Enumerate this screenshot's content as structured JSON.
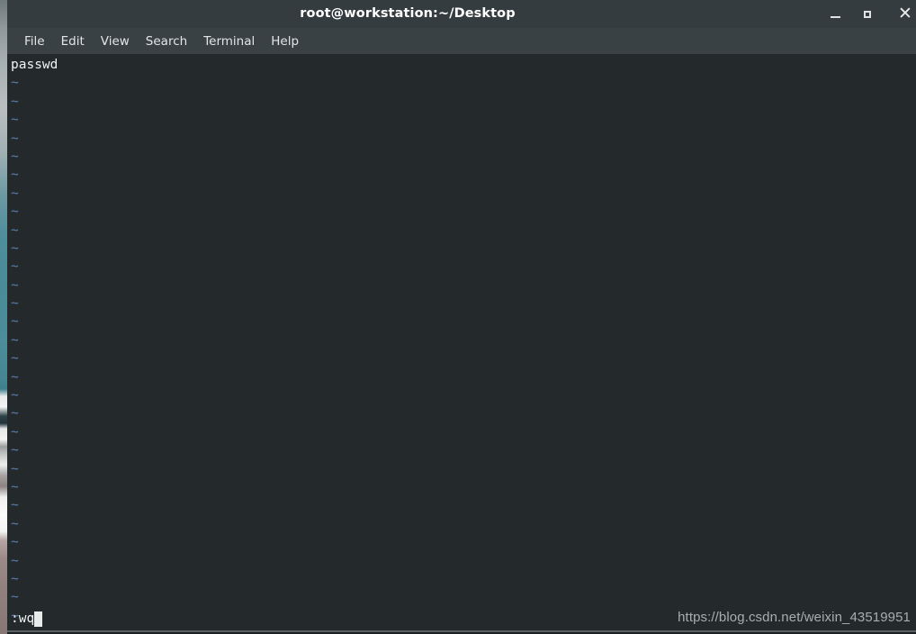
{
  "window": {
    "title": "root@workstation:~/Desktop",
    "controls": [
      {
        "name": "minimize",
        "label": "—"
      },
      {
        "name": "maximize",
        "label": "▫"
      },
      {
        "name": "close",
        "label": "×"
      }
    ]
  },
  "menu": {
    "items": [
      {
        "label": "File"
      },
      {
        "label": "Edit"
      },
      {
        "label": "View"
      },
      {
        "label": "Search"
      },
      {
        "label": "Terminal"
      },
      {
        "label": "Help"
      }
    ]
  },
  "terminal": {
    "editor": "vim",
    "first_line": "passwd",
    "empty_line_marker": "~",
    "empty_line_count": 30,
    "status_command": ":wq",
    "cursor": "block"
  },
  "watermark": {
    "text": "https://blog.csdn.net/weixin_43519951"
  },
  "colors": {
    "titlebar_bg": "#353c3f",
    "menubar_bg": "#3a4144",
    "terminal_bg": "#24292c",
    "terminal_fg": "#f1f3f3",
    "tilde_fg": "#5c7fb0",
    "cursor": "#e9ebeb",
    "watermark_fg": "#a9adad"
  }
}
